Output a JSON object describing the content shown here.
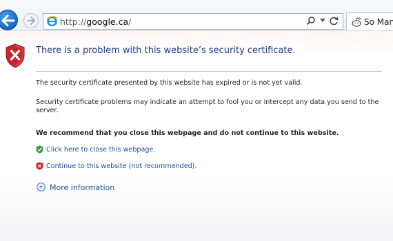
{
  "browser": {
    "address": {
      "prefix": "http://",
      "host": "google.ca",
      "suffix": "/"
    },
    "tab": {
      "label": "So Many"
    },
    "icons": {
      "back": "back-arrow-icon",
      "forward": "forward-arrow-icon",
      "site": "ie-logo-icon",
      "search": "search-icon",
      "dropdown": "chevron-down-icon",
      "refresh": "refresh-icon",
      "tab_favicon": "reddit-alien-icon"
    }
  },
  "page": {
    "title": "There is a problem with this website’s security certificate.",
    "paragraph1": "The security certificate presented by this website has expired or is not yet valid.",
    "paragraph2": "Security certificate problems may indicate an attempt to fool you or intercept any data you send to the server.",
    "recommendation": "We recommend that you close this webpage and do not continue to this website.",
    "close_link": "Click here to close this webpage.",
    "continue_link": "Continue to this website (not recommended).",
    "more_info": "More information"
  },
  "colors": {
    "title": "#1f3c88",
    "link": "#1a4f96",
    "shield_red": "#c8242b",
    "shield_green": "#3a9a3a"
  }
}
